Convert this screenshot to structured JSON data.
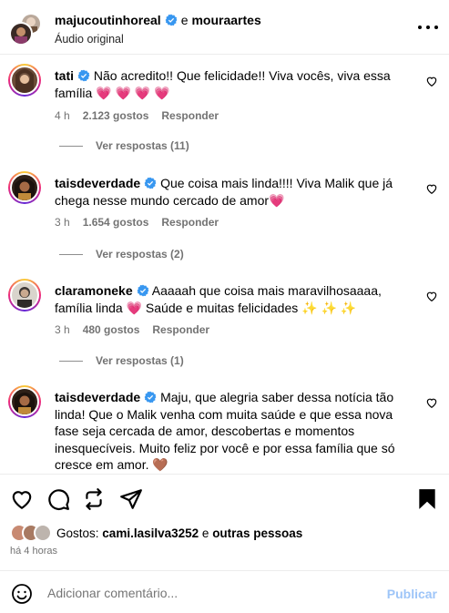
{
  "header": {
    "user1": "majucoutinhoreal",
    "and_text": "e",
    "user2": "mouraartes",
    "subtitle": "Áudio original"
  },
  "colors": {
    "verified": "#3897f0",
    "muted": "#737373",
    "publish": "#9ec5f8"
  },
  "comments": [
    {
      "username": "tati",
      "text": "Não acredito!! Que felicidade!! Viva vocês, viva essa família",
      "emojis": "💗 💗 💗 💗",
      "time": "4 h",
      "likes": "2.123 gostos",
      "reply": "Responder",
      "view_replies": "Ver respostas (11)"
    },
    {
      "username": "taisdeverdade",
      "text": "Que coisa mais linda!!!! Viva Malik que já chega nesse mundo cercado de amor",
      "emojis": "💗",
      "time": "3 h",
      "likes": "1.654 gostos",
      "reply": "Responder",
      "view_replies": "Ver respostas (2)"
    },
    {
      "username": "claramoneke",
      "text": "Aaaaah que coisa mais maravilhosaaaa, família linda",
      "text2": "Saúde e muitas felicidades",
      "emojis": "💗",
      "emojis2": "✨ ✨ ✨",
      "time": "3 h",
      "likes": "480 gostos",
      "reply": "Responder",
      "view_replies": "Ver respostas (1)"
    },
    {
      "username": "taisdeverdade",
      "text": "Maju, que alegria saber dessa notícia tão linda! Que o Malik venha com muita saúde e que essa nova fase seja cercada de amor, descobertas e momentos inesquecíveis. Muito feliz por você e por essa família que só cresce em amor.",
      "emojis": "🤎"
    }
  ],
  "actions": {
    "like_icon": "heart-icon",
    "comment_icon": "comment-icon",
    "repost_icon": "repost-icon",
    "share_icon": "send-icon",
    "save_icon": "bookmark-icon"
  },
  "liked_by": {
    "prefix": "Gostos:",
    "user": "cami.lasilva3252",
    "middle": "e",
    "others": "outras pessoas"
  },
  "time_ago": "há 4 horas",
  "add_comment": {
    "placeholder": "Adicionar comentário...",
    "publish": "Publicar"
  }
}
